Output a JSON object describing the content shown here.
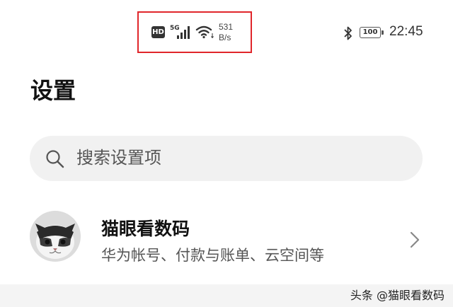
{
  "status_bar": {
    "hd_badge": "HD",
    "network_type": "5G",
    "speed_value": "531",
    "speed_unit": "B/s",
    "battery_level": "100",
    "time": "22:45",
    "icons": [
      "signal-icon",
      "wifi-icon",
      "bluetooth-icon",
      "battery-icon"
    ],
    "highlight_color": "#e0262b"
  },
  "header": {
    "title": "设置"
  },
  "search": {
    "placeholder": "搜索设置项"
  },
  "account": {
    "name": "猫眼看数码",
    "subtitle": "华为帐号、付款与账单、云空间等"
  },
  "watermark": {
    "text": "头条 @猫眼看数码"
  }
}
